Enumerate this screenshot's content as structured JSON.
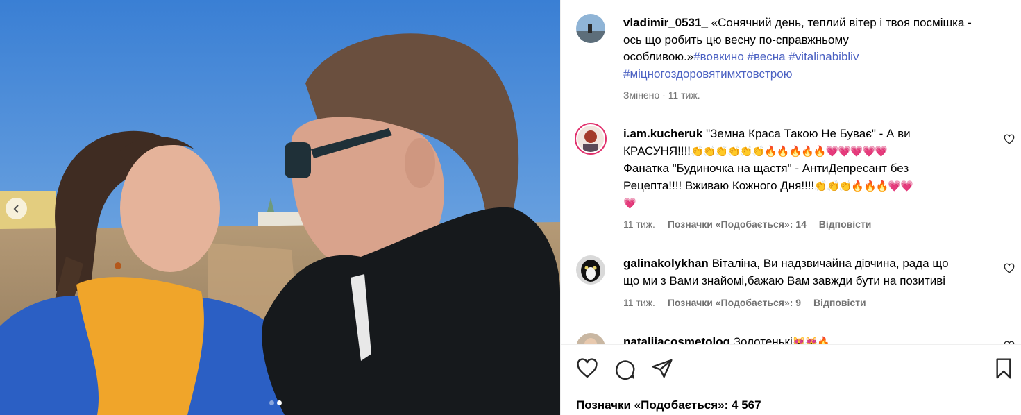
{
  "post": {
    "author": "vladimir_0531_",
    "caption_line1": "«Сонячний день, теплий вітер і твоя посмішка -",
    "caption_line2": "ось що робить цю весну по-справжньому",
    "caption_line3": "особливою.»",
    "hashtags": [
      "#вовкино",
      "#весна",
      "#vitalinabibliv",
      "#міцногоздоровятимхтовстрою"
    ],
    "edited": "Змінено",
    "time": "11 тиж.",
    "likes_text": "Позначки «Подобається»: 4 567",
    "carousel_total": 2,
    "carousel_active": 2
  },
  "comments": [
    {
      "user": "i.am.kucheruk",
      "lines": [
        "\"Земна Краса Такою Не Буває\" - А ви",
        "КРАСУНЯ!!!!",
        "Фанатка \"Будиночка на щастя\" - АнтиДепресант без",
        "Рецепта!!!! Вживаю Кожного Дня!!!!"
      ],
      "emoji_line2": "👏👏👏👏👏👏🔥🔥🔥🔥🔥💗💗💗💗💗",
      "emoji_line4": "👏👏👏🔥🔥🔥💗💗",
      "emoji_line5": "💗",
      "time": "11 тиж.",
      "likes": "Позначки «Подобається»: 14",
      "reply": "Відповісти"
    },
    {
      "user": "galinakolykhan",
      "lines": [
        "Віталіна, Ви надзвичайна дівчина, рада що",
        "що ми з Вами знайомі,бажаю Вам завжди бути на позитиві"
      ],
      "time": "11 тиж.",
      "likes": "Позначки «Подобається»: 9",
      "reply": "Відповісти"
    },
    {
      "user": "nataliiacosmetolog",
      "text": "Золотенькі",
      "emoji": "😻😻🔥"
    }
  ],
  "icons": {
    "like": "heart-icon",
    "comment": "comment-icon",
    "share": "send-icon",
    "save": "bookmark-icon",
    "comment_like": "heart-icon",
    "prev": "chevron-left-icon"
  },
  "colors": {
    "hashtag": "#4b61c2",
    "meta": "#737373",
    "sky": "#3f86d6"
  }
}
